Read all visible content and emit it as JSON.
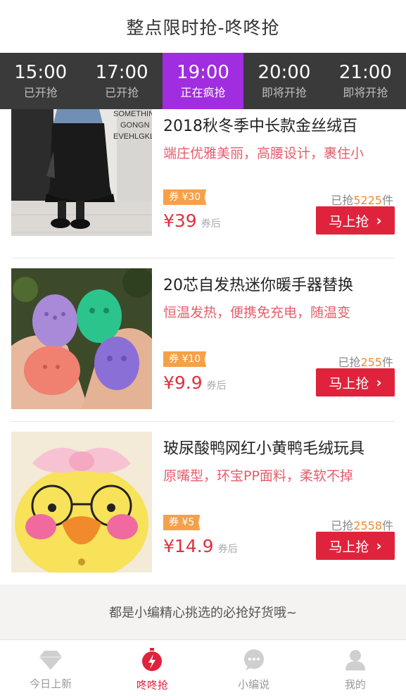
{
  "header": {
    "title": "整点限时抢-咚咚抢"
  },
  "time_tabs": [
    {
      "time": "15:00",
      "status": "已开抢"
    },
    {
      "time": "17:00",
      "status": "已开抢"
    },
    {
      "time": "19:00",
      "status": "正在疯抢"
    },
    {
      "time": "20:00",
      "status": "即将开抢"
    },
    {
      "time": "21:00",
      "status": "即将开抢"
    }
  ],
  "active_tab_index": 2,
  "products": [
    {
      "title": "2018秋冬季中长款金丝绒百",
      "desc": "端庄优雅美丽，高腰设计，裹住小",
      "coupon": "券 ¥30",
      "sold_prefix": "已抢",
      "sold_count": "5225",
      "sold_suffix": "件",
      "price": "¥39",
      "price_suffix": "券后",
      "button": "马上抢",
      "photo_text": [
        "SOMETHIN",
        "GONGN",
        "EVEHLGKLY"
      ]
    },
    {
      "title": "20芯自发热迷你暖手器替换",
      "desc": "恒温发热，便携免充电，随温变",
      "coupon": "券 ¥10",
      "sold_prefix": "已抢",
      "sold_count": "255",
      "sold_suffix": "件",
      "price": "¥9.9",
      "price_suffix": "券后",
      "button": "马上抢"
    },
    {
      "title": "玻尿酸鸭网红小黄鸭毛绒玩具",
      "desc": "原嘴型，环宝PP面料，柔软不掉",
      "coupon": "券 ¥5",
      "sold_prefix": "已抢",
      "sold_count": "2558",
      "sold_suffix": "件",
      "price": "¥14.9",
      "price_suffix": "券后",
      "button": "马上抢"
    }
  ],
  "footer_note": "都是小编精心挑选的必抢好货哦~",
  "bottom_nav": [
    {
      "label": "今日上新",
      "icon": "diamond-icon"
    },
    {
      "label": "咚咚抢",
      "icon": "stopwatch-icon"
    },
    {
      "label": "小编说",
      "icon": "chat-icon"
    },
    {
      "label": "我的",
      "icon": "user-icon"
    }
  ],
  "colors": {
    "accent_purple": "#a02de0",
    "accent_red": "#e0233c",
    "coupon_orange": "#f6a04a",
    "desc_pink": "#e55d6b",
    "tab_bar": "#3a3a3a"
  }
}
